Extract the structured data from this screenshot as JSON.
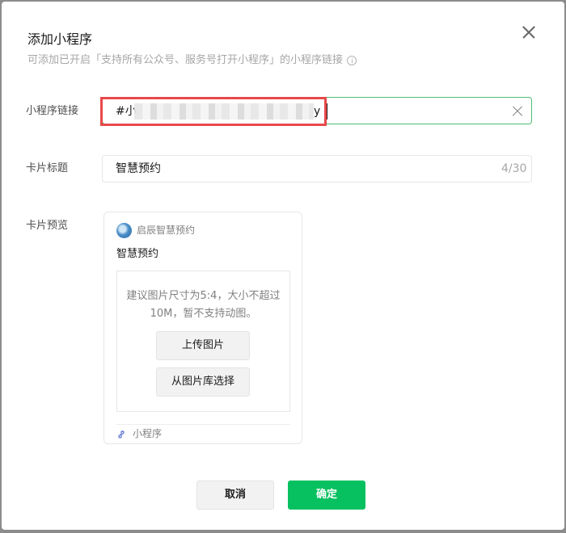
{
  "dialog": {
    "title": "添加小程序",
    "subtitle": "可添加已开启「支持所有公众号、服务号打开小程序」的小程序链接"
  },
  "link_field": {
    "label": "小程序链接",
    "value_prefix": "#小",
    "value_suffix": "y"
  },
  "title_field": {
    "label": "卡片标题",
    "value": "智慧预约",
    "counter": "4/30"
  },
  "preview": {
    "label": "卡片预览",
    "app_name": "启辰智慧预约",
    "card_title": "智慧预约",
    "upload_hint": "建议图片尺寸为5:4，大小不超过10M，暂不支持动图。",
    "upload_button": "上传图片",
    "library_button": "从图片库选择",
    "footer_label": "小程序"
  },
  "actions": {
    "cancel": "取消",
    "confirm": "确定"
  },
  "colors": {
    "primary": "#07c160",
    "focus_border": "#4ebd72",
    "highlight": "#e8494a"
  },
  "icons": {
    "close": "close-icon",
    "info": "info-icon",
    "clear": "clear-icon",
    "miniprogram": "miniprogram-link-icon"
  }
}
